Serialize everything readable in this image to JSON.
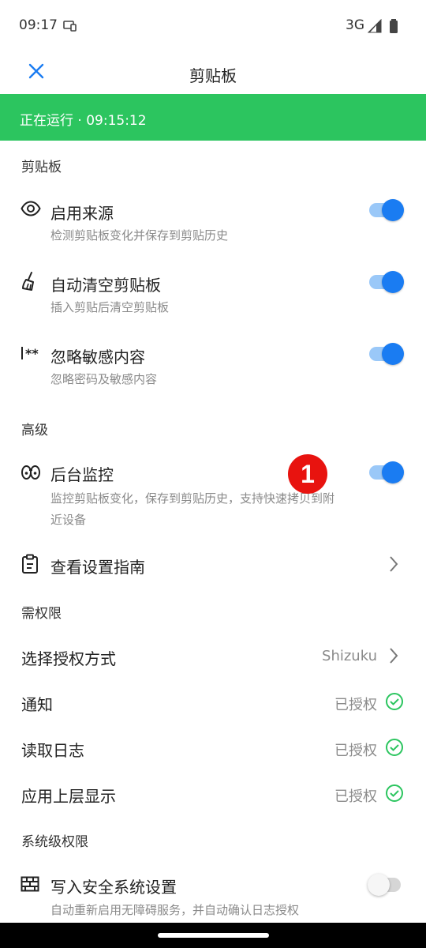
{
  "status_bar": {
    "time": "09:17",
    "network": "3G",
    "icons": [
      "cast-icon",
      "signal-icon",
      "battery-icon"
    ]
  },
  "app_bar": {
    "title": "剪贴板",
    "close_icon": "close-icon"
  },
  "banner": {
    "text": "正在运行 · 09:15:12",
    "color": "#2cc55f"
  },
  "sections": {
    "clipboard": {
      "header": "剪贴板",
      "items": [
        {
          "icon": "eye-icon",
          "title": "启用来源",
          "subtitle": "检测剪贴板变化并保存到剪贴历史",
          "enabled": true
        },
        {
          "icon": "broom-icon",
          "title": "自动清空剪贴板",
          "subtitle": "插入剪贴后清空剪贴板",
          "enabled": true
        },
        {
          "icon": "password-icon",
          "title": "忽略敏感内容",
          "subtitle": "忽略密码及敏感内容",
          "enabled": true
        }
      ]
    },
    "advanced": {
      "header": "高级",
      "monitor": {
        "icon": "binoculars-icon",
        "title": "后台监控",
        "subtitle": "监控剪贴板变化，保存到剪贴历史，支持快速拷贝到附近设备",
        "enabled": true
      },
      "guide": {
        "icon": "clipboard-icon",
        "title": "查看设置指南"
      }
    },
    "permissions": {
      "header": "需权限",
      "auth_method": {
        "title": "选择授权方式",
        "value": "Shizuku"
      },
      "items": [
        {
          "title": "通知",
          "status": "已授权"
        },
        {
          "title": "读取日志",
          "status": "已授权"
        },
        {
          "title": "应用上层显示",
          "status": "已授权"
        }
      ]
    },
    "system": {
      "header": "系统级权限",
      "secure_settings": {
        "icon": "wall-icon",
        "title": "写入安全系统设置",
        "subtitle": "自动重新启用无障碍服务，并自动确认日志授权",
        "enabled": false
      }
    }
  },
  "annotation_badge": "1",
  "colors": {
    "accent": "#1a7cf2",
    "success": "#2cc55f",
    "badge": "#e8130f"
  }
}
